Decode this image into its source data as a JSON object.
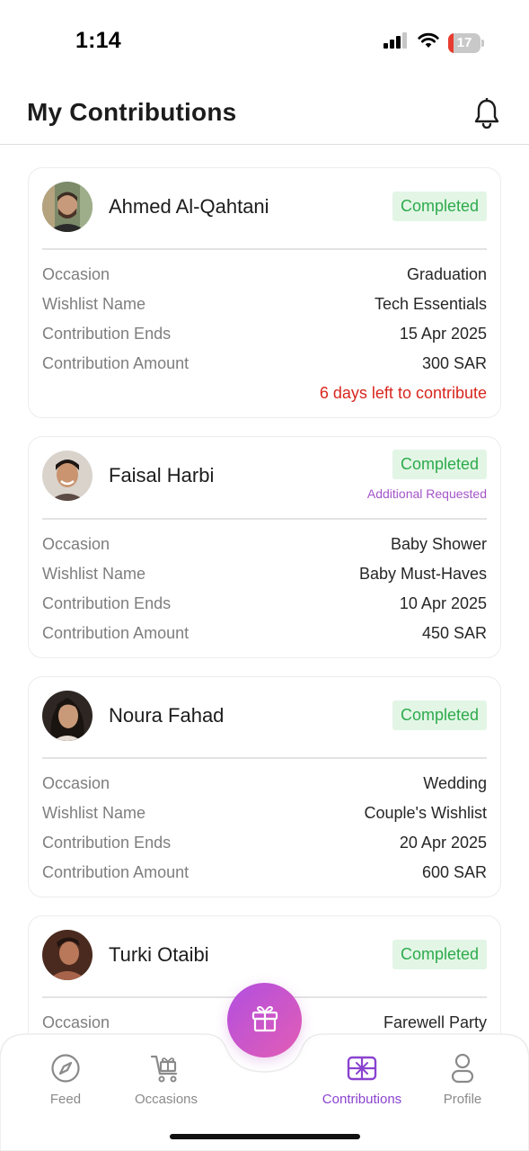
{
  "status_bar": {
    "time": "1:14",
    "battery": "17",
    "battery_level": 0.17
  },
  "header": {
    "title": "My Contributions"
  },
  "contributions": [
    {
      "name": "Ahmed Al-Qahtani",
      "status": "Completed",
      "rows": [
        {
          "label": "Occasion",
          "value": "Graduation"
        },
        {
          "label": "Wishlist Name",
          "value": "Tech Essentials"
        },
        {
          "label": "Contribution Ends",
          "value": "15 Apr 2025"
        },
        {
          "label": "Contribution Amount",
          "value": "300 SAR"
        }
      ],
      "deadline_note": "6 days left to contribute"
    },
    {
      "name": "Faisal Harbi",
      "status": "Completed",
      "sub_status": "Additional Requested",
      "rows": [
        {
          "label": "Occasion",
          "value": "Baby Shower"
        },
        {
          "label": "Wishlist Name",
          "value": "Baby Must-Haves"
        },
        {
          "label": "Contribution Ends",
          "value": "10 Apr 2025"
        },
        {
          "label": "Contribution Amount",
          "value": "450 SAR"
        }
      ]
    },
    {
      "name": "Noura Fahad",
      "status": "Completed",
      "rows": [
        {
          "label": "Occasion",
          "value": "Wedding"
        },
        {
          "label": "Wishlist Name",
          "value": "Couple's Wishlist"
        },
        {
          "label": "Contribution Ends",
          "value": "20 Apr 2025"
        },
        {
          "label": "Contribution Amount",
          "value": "600 SAR"
        }
      ]
    },
    {
      "name": "Turki Otaibi",
      "status": "Completed",
      "rows": [
        {
          "label": "Occasion",
          "value": "Farewell Party"
        }
      ]
    }
  ],
  "bottom_nav": {
    "items": [
      {
        "label": "Feed",
        "icon": "compass-icon"
      },
      {
        "label": "Occasions",
        "icon": "gift-cart-icon"
      },
      {
        "label": "Contributions",
        "icon": "contributions-icon",
        "active": true
      },
      {
        "label": "Profile",
        "icon": "person-icon"
      }
    ],
    "center_action_icon": "gift-icon"
  },
  "colors": {
    "accent": "#8a43cf",
    "completed_text": "#2daa4c",
    "completed_bg": "#e3f6e6",
    "deadline": "#d8261e",
    "sub_status": "#a454c9"
  }
}
